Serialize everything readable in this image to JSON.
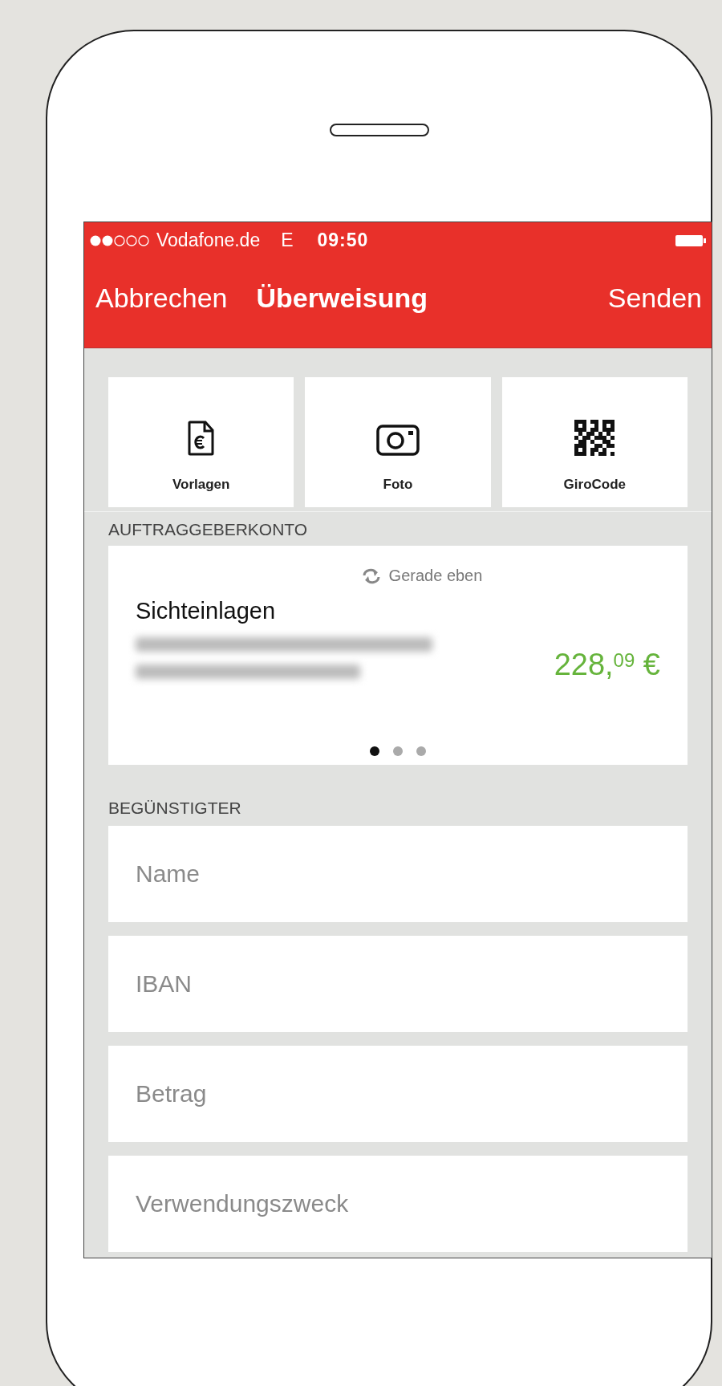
{
  "status_bar": {
    "carrier": "Vodafone.de",
    "network": "E",
    "time": "09:50"
  },
  "nav_bar": {
    "cancel": "Abbrechen",
    "title": "Überweisung",
    "send": "Senden"
  },
  "actions": [
    {
      "kind": "template",
      "label": "Vorlagen"
    },
    {
      "kind": "photo",
      "label": "Foto"
    },
    {
      "kind": "qr",
      "label": "GiroCode"
    }
  ],
  "sender_section": {
    "header": "AUFTRAGGEBERKONTO",
    "account": {
      "updated": "Gerade eben",
      "name": "Sichteinlagen",
      "balance": "228,$^{09}$ €",
      "pages": [
        {
          "selected": true
        },
        {
          "selected": false
        },
        {
          "selected": false
        }
      ]
    }
  },
  "beneficiary_section": {
    "header": "BEGÜNSTIGTER",
    "fields": [
      {
        "placeholder": "Name"
      },
      {
        "placeholder": "IBAN"
      },
      {
        "placeholder": "Betrag"
      },
      {
        "placeholder": "Verwendungszweck"
      }
    ]
  }
}
